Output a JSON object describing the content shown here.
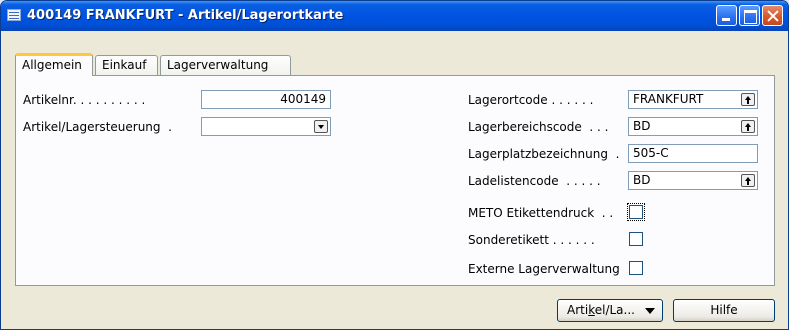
{
  "window": {
    "title": "400149 FRANKFURT - Artikel/Lagerortkarte"
  },
  "tabs": [
    {
      "label": "Allgemein",
      "active": true
    },
    {
      "label": "Einkauf",
      "active": false
    },
    {
      "label": "Lagerverwaltung",
      "active": false
    }
  ],
  "left": {
    "artikelnr_label": "Artikelnr. . . . . . . . . .",
    "artikelnr_value": "400149",
    "steuerung_label": "Artikel/Lagersteuerung  .",
    "steuerung_value": ""
  },
  "right": {
    "lagerortcode_label": "Lagerortcode . . . . . .",
    "lagerortcode_value": "FRANKFURT",
    "lagerbereichscode_label": "Lagerbereichscode  . . .",
    "lagerbereichscode_value": "BD",
    "lagerplatz_label": "Lagerplatzbezeichnung  .",
    "lagerplatz_value": "505-C",
    "ladelisten_label": "Ladelistencode  . . . . .",
    "ladelisten_value": "BD",
    "meto_label": "METO Etikettendruck  . .",
    "meto_checked": false,
    "sonder_label": "Sonderetikett . . . . . .",
    "sonder_checked": false,
    "extern_label": "Externe Lagerverwaltung",
    "extern_checked": false
  },
  "buttons": {
    "artikel_prefix": "Arti",
    "artikel_hotkey": "k",
    "artikel_suffix": "el/La...",
    "hilfe": "Hilfe"
  },
  "colors": {
    "titlebar": "#0054e3",
    "active_tab_accent": "#ffc73c",
    "window_bg": "#ece9d8"
  }
}
